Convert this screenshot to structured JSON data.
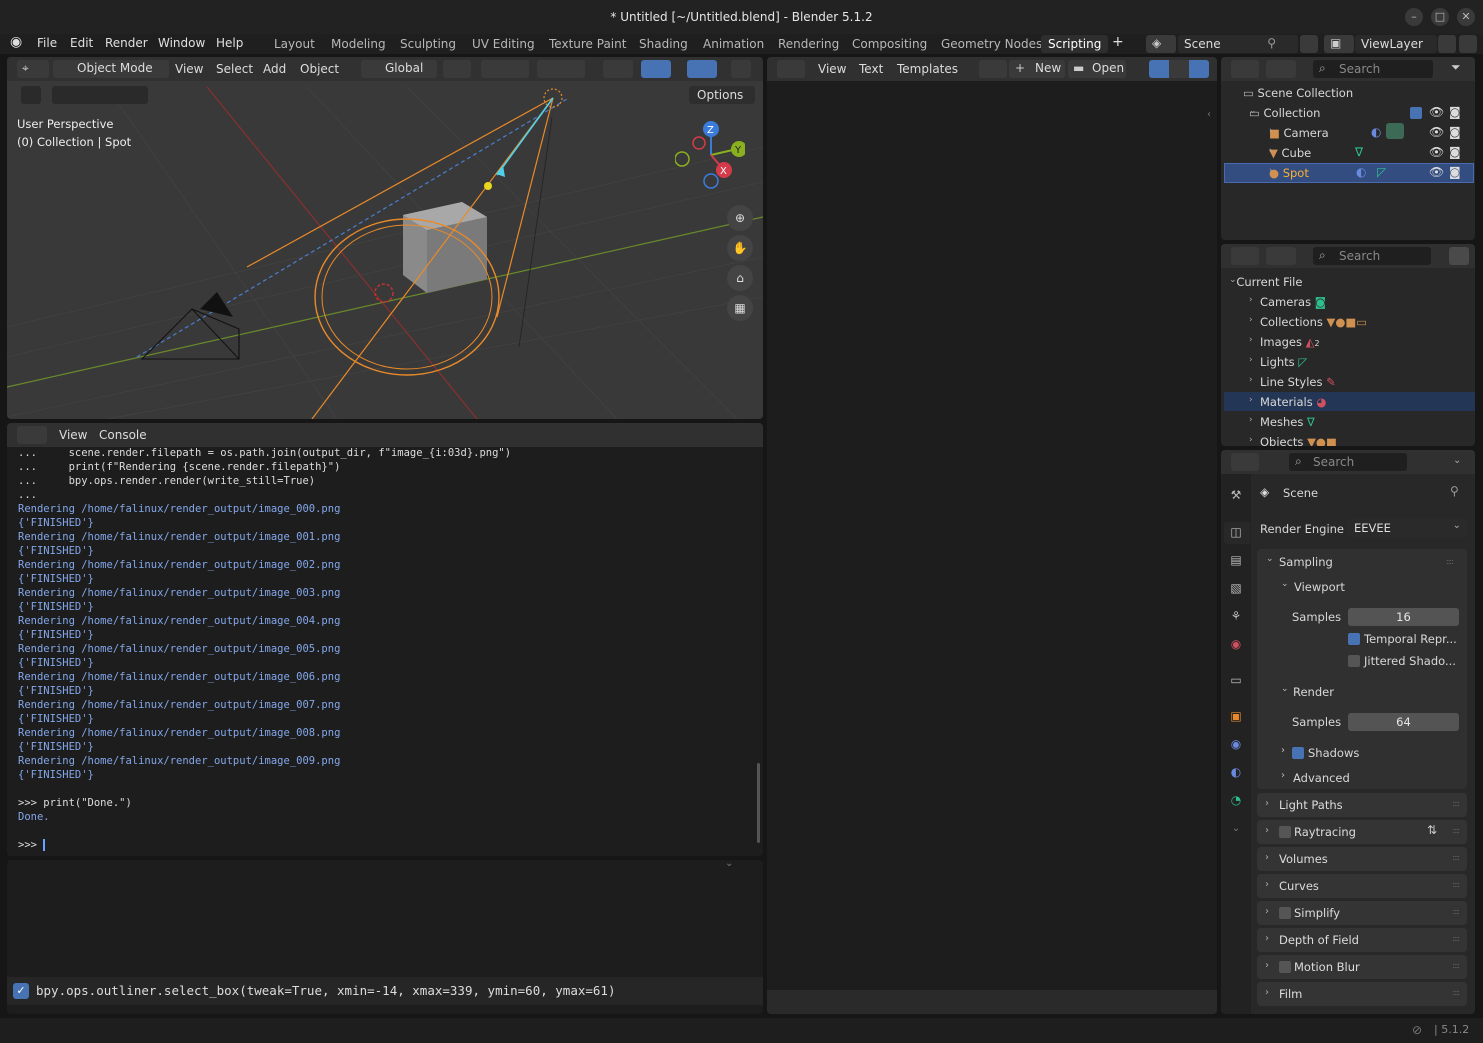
{
  "window": {
    "title": "* Untitled [~/Untitled.blend] - Blender 5.1.2"
  },
  "menu": {
    "file": "File",
    "edit": "Edit",
    "render": "Render",
    "window": "Window",
    "help": "Help"
  },
  "workspaces": [
    "Layout",
    "Modeling",
    "Sculpting",
    "UV Editing",
    "Texture Paint",
    "Shading",
    "Animation",
    "Rendering",
    "Compositing",
    "Geometry Nodes",
    "Scripting"
  ],
  "scene": {
    "name": "Scene",
    "view_layer": "ViewLayer"
  },
  "viewport": {
    "mode": "Object Mode",
    "menus": [
      "View",
      "Select",
      "Add",
      "Object"
    ],
    "transform": "Global",
    "options": "Options",
    "perspective": "User Perspective",
    "context": "(0) Collection | Spot",
    "axes": {
      "x": "X",
      "y": "Y",
      "z": "Z"
    }
  },
  "console": {
    "menus": [
      "View",
      "Console"
    ],
    "script_lines": [
      "...     scene.render.filepath = os.path.join(output_dir, f\"image_{i:03d}.png\")",
      "...     print(f\"Rendering {scene.render.filepath}\")",
      "...     bpy.ops.render.render(write_still=True)",
      "..."
    ],
    "output": [
      "Rendering /home/falinux/render_output/image_000.png",
      "{'FINISHED'}",
      "Rendering /home/falinux/render_output/image_001.png",
      "{'FINISHED'}",
      "Rendering /home/falinux/render_output/image_002.png",
      "{'FINISHED'}",
      "Rendering /home/falinux/render_output/image_003.png",
      "{'FINISHED'}",
      "Rendering /home/falinux/render_output/image_004.png",
      "{'FINISHED'}",
      "Rendering /home/falinux/render_output/image_005.png",
      "{'FINISHED'}",
      "Rendering /home/falinux/render_output/image_006.png",
      "{'FINISHED'}",
      "Rendering /home/falinux/render_output/image_007.png",
      "{'FINISHED'}",
      "Rendering /home/falinux/render_output/image_008.png",
      "{'FINISHED'}",
      "Rendering /home/falinux/render_output/image_009.png",
      "{'FINISHED'}"
    ],
    "print_cmd": ">>> print(\"Done.\")",
    "done": "Done.",
    "prompt": ">>> "
  },
  "info_log": "bpy.ops.outliner.select_box(tweak=True, xmin=-14, xmax=339, ymin=60, ymax=61)",
  "text_editor": {
    "menus": [
      "View",
      "Text",
      "Templates"
    ],
    "new": "New",
    "open": "Open"
  },
  "outliner": {
    "search_placeholder": "Search",
    "scene_collection": "Scene Collection",
    "collection": "Collection",
    "items": [
      "Camera",
      "Cube",
      "Spot"
    ]
  },
  "blend_data": {
    "search_placeholder": "Search",
    "root": "Current File",
    "items": [
      "Cameras",
      "Collections",
      "Images",
      "Lights",
      "Line Styles",
      "Materials",
      "Meshes",
      "Objects"
    ],
    "images_count": "2"
  },
  "properties": {
    "search_placeholder": "Search",
    "context": "Scene",
    "render_engine_label": "Render Engine",
    "render_engine": "EEVEE",
    "sampling": "Sampling",
    "viewport": "Viewport",
    "samples_label": "Samples",
    "viewport_samples": "16",
    "temporal": "Temporal Repr...",
    "jittered": "Jittered Shado...",
    "render": "Render",
    "render_samples": "64",
    "shadows": "Shadows",
    "advanced": "Advanced",
    "panels": [
      "Light Paths",
      "Raytracing",
      "Volumes",
      "Curves",
      "Simplify",
      "Depth of Field",
      "Motion Blur",
      "Film"
    ]
  },
  "statusbar": {
    "version": "5.1.2"
  }
}
